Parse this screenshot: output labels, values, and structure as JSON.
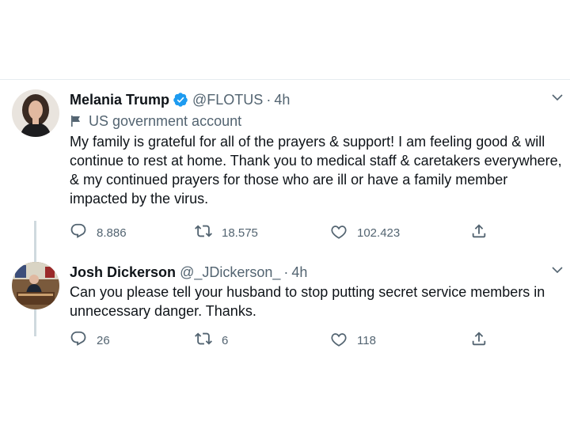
{
  "tweets": [
    {
      "name": "Melania Trump",
      "verified": true,
      "handle": "@FLOTUS",
      "separator": "·",
      "time": "4h",
      "gov_label": "US government account",
      "text": "My family is grateful for all of the prayers & support! I am feeling good & will continue to rest at home. Thank you to medical staff & caretakers everywhere, & my continued prayers for those who are ill or have a family member impacted by the virus.",
      "replies": "8.886",
      "retweets": "18.575",
      "likes": "102.423"
    },
    {
      "name": "Josh Dickerson",
      "verified": false,
      "handle": "@_JDickerson_",
      "separator": "·",
      "time": "4h",
      "text": "Can you please tell your husband to stop putting secret service members in unnecessary danger. Thanks.",
      "replies": "26",
      "retweets": "6",
      "likes": "118"
    }
  ],
  "colors": {
    "verified_blue": "#1d9bf0",
    "secondary_text": "#536471",
    "divider": "#e6ecf0"
  },
  "icons": [
    "verified-badge-icon",
    "flag-icon",
    "reply-icon",
    "retweet-icon",
    "like-icon",
    "share-icon",
    "chevron-down-icon"
  ]
}
